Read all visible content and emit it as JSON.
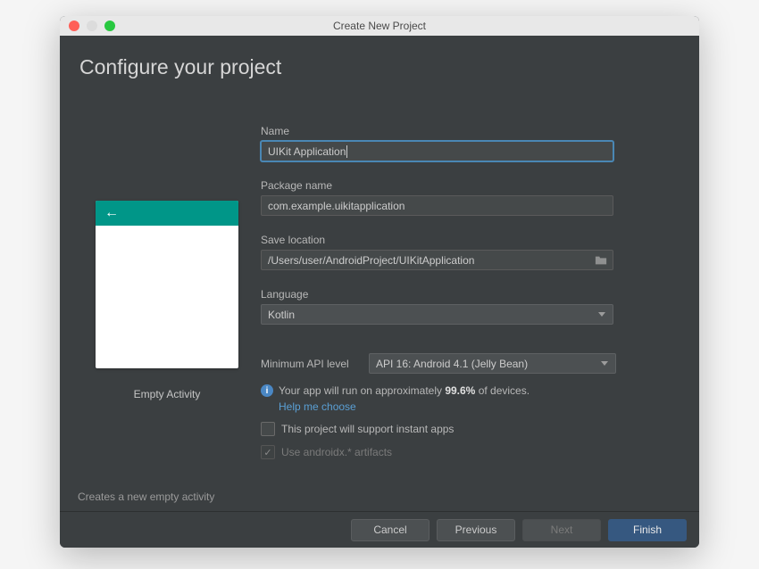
{
  "titlebar": {
    "title": "Create New Project"
  },
  "heading": "Configure your project",
  "thumbnail": {
    "label": "Empty Activity"
  },
  "left_description": "Creates a new empty activity",
  "form": {
    "name_label": "Name",
    "name_value": "UIKit Application",
    "package_label": "Package name",
    "package_value": "com.example.uikitapplication",
    "save_label": "Save location",
    "save_value": "/Users/user/AndroidProject/UIKitApplication",
    "language_label": "Language",
    "language_value": "Kotlin",
    "api_label": "Minimum API level",
    "api_value": "API 16: Android 4.1 (Jelly Bean)",
    "info_prefix": "Your app will run on approximately ",
    "info_percent": "99.6%",
    "info_suffix": " of devices.",
    "help_link": "Help me choose",
    "instant_apps_label": "This project will support instant apps",
    "androidx_label": "Use androidx.* artifacts"
  },
  "footer": {
    "cancel": "Cancel",
    "previous": "Previous",
    "next": "Next",
    "finish": "Finish"
  }
}
